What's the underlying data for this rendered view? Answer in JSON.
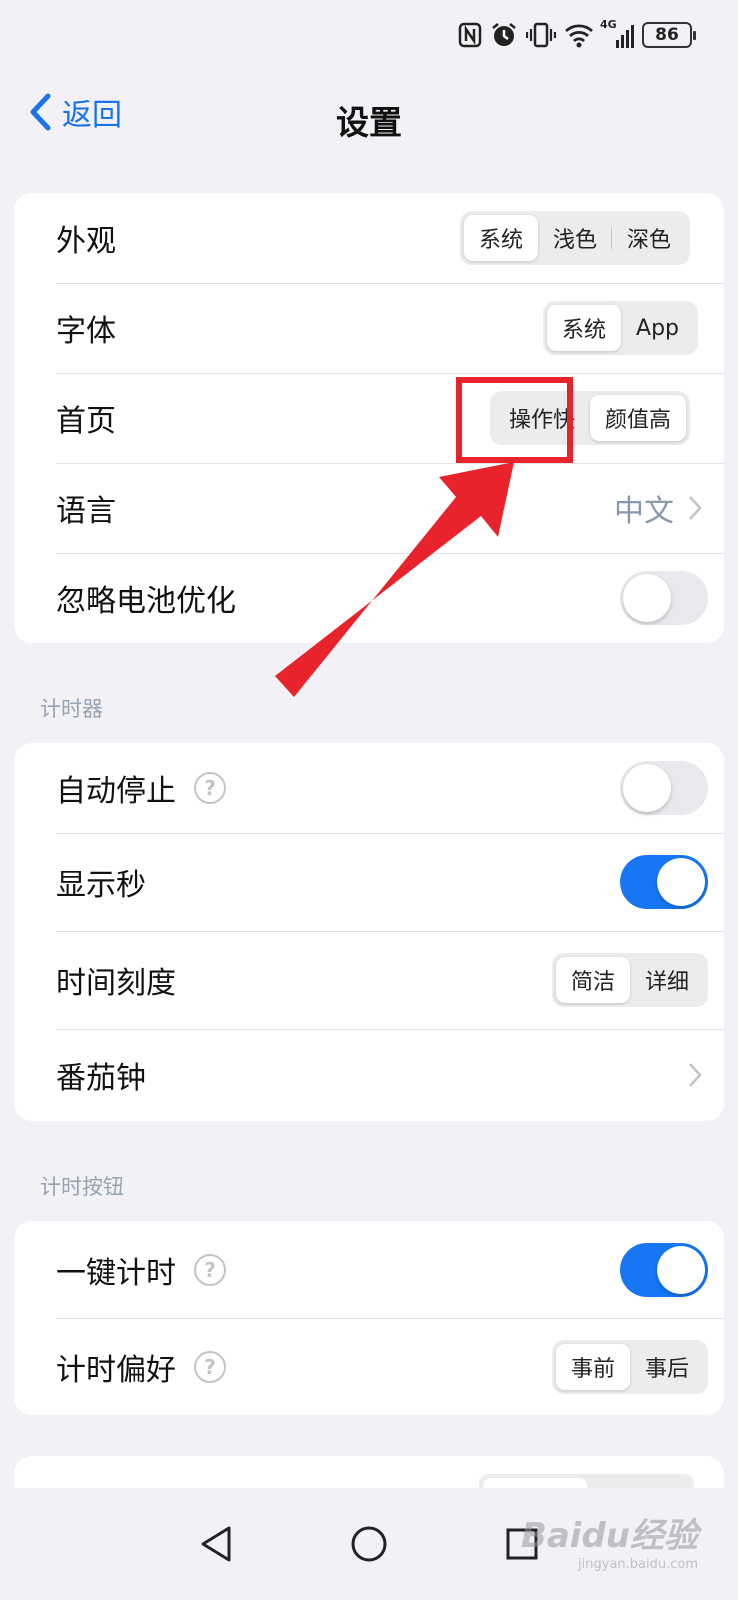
{
  "status_bar": {
    "icons": [
      "nfc-icon",
      "alarm-icon",
      "vibrate-icon",
      "wifi-icon",
      "signal-4g-icon"
    ],
    "network_label": "4G",
    "battery": "86"
  },
  "nav": {
    "back_label": "返回",
    "title": "设置"
  },
  "general": {
    "appearance": {
      "label": "外观",
      "options": [
        "系统",
        "浅色",
        "深色"
      ],
      "selected": "系统"
    },
    "font": {
      "label": "字体",
      "options": [
        "系统",
        "App"
      ],
      "selected": "系统"
    },
    "home": {
      "label": "首页",
      "options": [
        "操作快",
        "颜值高"
      ],
      "selected": "颜值高"
    },
    "language": {
      "label": "语言",
      "value": "中文"
    },
    "ignore_battery": {
      "label": "忽略电池优化",
      "enabled": false
    }
  },
  "timer_section": {
    "header": "计时器",
    "auto_stop": {
      "label": "自动停止",
      "enabled": false
    },
    "show_seconds": {
      "label": "显示秒",
      "enabled": true
    },
    "time_scale": {
      "label": "时间刻度",
      "options": [
        "简洁",
        "详细"
      ],
      "selected": "简洁"
    },
    "pomodoro": {
      "label": "番茄钟"
    }
  },
  "timer_button_section": {
    "header": "计时按钮",
    "one_tap": {
      "label": "一键计时",
      "enabled": true
    },
    "preference": {
      "label": "计时偏好",
      "options": [
        "事前",
        "事后"
      ],
      "selected": "事前"
    }
  },
  "help_symbol": "?",
  "watermark": {
    "text": "Baidu经验",
    "sub": "jingyan.baidu.com"
  },
  "colors": {
    "accent": "#1676f3",
    "annotation": "#e8232b",
    "link": "#1a73e8"
  }
}
